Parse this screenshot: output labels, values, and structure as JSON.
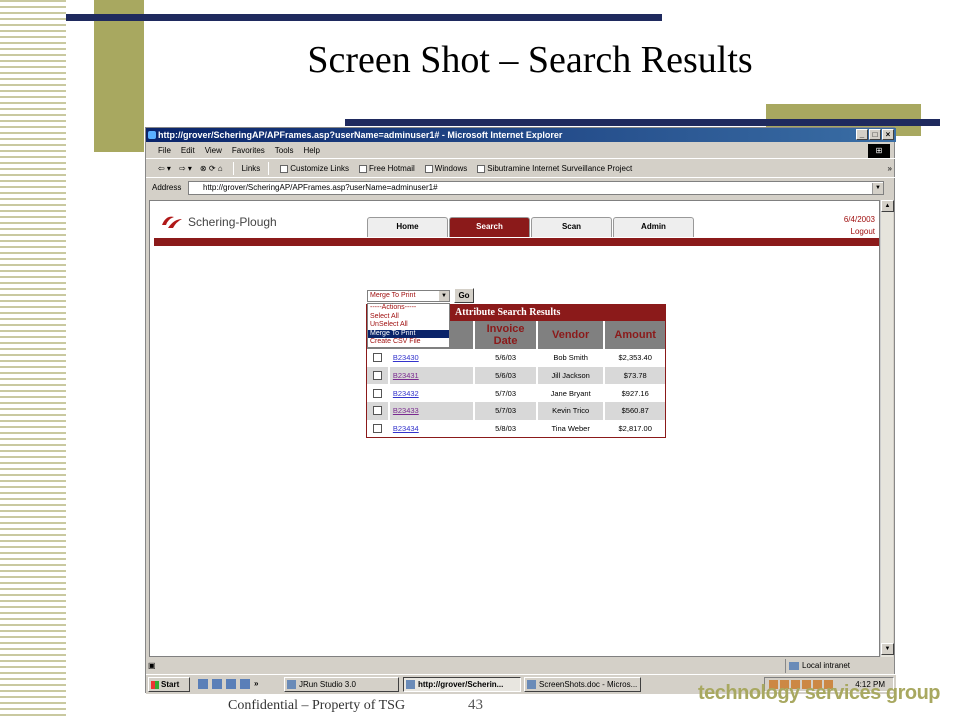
{
  "slide": {
    "title": "Screen Shot – Search Results",
    "footer_confidential": "Confidential – Property of TSG",
    "footer_page": "43",
    "footer_brand": "technology services group"
  },
  "colors": {
    "navy": "#1f2a5e",
    "olive": "#a8a860",
    "maroon": "#8b1a1a",
    "gray_header": "#808080"
  },
  "browser": {
    "title": "http://grover/ScheringAP/APFrames.asp?userName=adminuser1# - Microsoft Internet Explorer",
    "window_buttons": [
      "_",
      "□",
      "×"
    ],
    "menu": [
      "File",
      "Edit",
      "View",
      "Favorites",
      "Tools",
      "Help"
    ],
    "toolbar": {
      "back": "⇦ ▾",
      "forward": "⇨ ▾",
      "stop_refresh_home": "⊗ ⟳ ⌂",
      "links_label": "Links",
      "links": [
        "Customize Links",
        "Free Hotmail",
        "Windows",
        "Sibutramine Internet Surveillance Project"
      ],
      "chevron": "»"
    },
    "address_label": "Address",
    "address_value": "http://grover/ScheringAP/APFrames.asp?userName=adminuser1#",
    "status_zone": "Local intranet"
  },
  "taskbar": {
    "start": "Start",
    "chevron": "»",
    "tasks": [
      "JRun Studio 3.0",
      "http://grover/Scherin...",
      "ScreenShots.doc - Micros..."
    ],
    "clock": "4:12 PM"
  },
  "webpage": {
    "logo_text": "Schering-Plough",
    "nav_tabs": [
      "Home",
      "Search",
      "Scan",
      "Admin"
    ],
    "active_tab": "Search",
    "date": "6/4/2003",
    "logout": "Logout",
    "action_select_value": "Merge To Print",
    "go_label": "Go",
    "action_options": [
      "-----Actions-----",
      "Select All",
      "UnSelect All",
      "Merge To Print",
      "Create CSV File"
    ],
    "results": {
      "title": "Attribute Search Results",
      "headers": [
        "Invoice Date",
        "Vendor",
        "Amount"
      ],
      "rows": [
        {
          "invoice": "B23430",
          "date": "5/6/03",
          "vendor": "Bob Smith",
          "amount": "$2,353.40"
        },
        {
          "invoice": "B23431",
          "date": "5/6/03",
          "vendor": "Jill Jackson",
          "amount": "$73.78"
        },
        {
          "invoice": "B23432",
          "date": "5/7/03",
          "vendor": "Jane Bryant",
          "amount": "$927.16"
        },
        {
          "invoice": "B23433",
          "date": "5/7/03",
          "vendor": "Kevin Trico",
          "amount": "$560.87"
        },
        {
          "invoice": "B23434",
          "date": "5/8/03",
          "vendor": "Tina Weber",
          "amount": "$2,817.00"
        }
      ]
    }
  }
}
